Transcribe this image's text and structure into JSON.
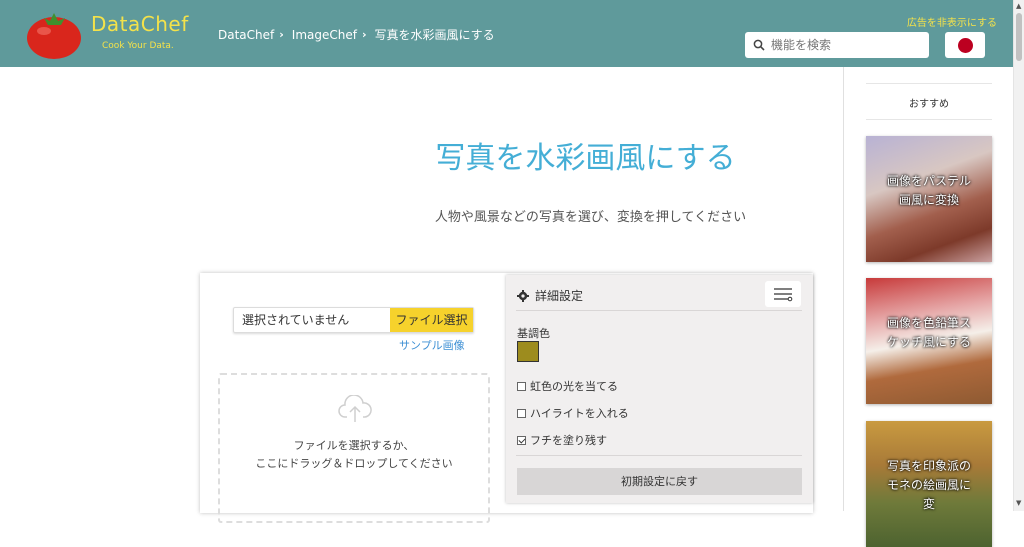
{
  "header": {
    "logo_title": "DataChef",
    "logo_tagline": "Cook Your Data.",
    "breadcrumbs": [
      "DataChef",
      "ImageChef",
      "写真を水彩画風にする"
    ],
    "ad_link": "広告を非表示にする",
    "search_placeholder": "機能を検索",
    "lang_flag": "japan-flag"
  },
  "main": {
    "title": "写真を水彩画風にする",
    "subtitle": "人物や風景などの写真を選び、変換を押してください",
    "file_value": "選択されていません",
    "file_button": "ファイル選択",
    "sample_link": "サンプル画像",
    "drop_line1": "ファイルを選択するか、",
    "drop_line2": "ここにドラッグ＆ドロップしてください"
  },
  "settings": {
    "title": "詳細設定",
    "base_color_label": "基調色",
    "base_color": "#9d8c1e",
    "options": [
      {
        "label": "虹色の光を当てる",
        "checked": false
      },
      {
        "label": "ハイライトを入れる",
        "checked": false
      },
      {
        "label": "フチを塗り残す",
        "checked": true
      }
    ],
    "reset_button": "初期設定に戻す"
  },
  "sidebar": {
    "title": "おすすめ",
    "items": [
      {
        "caption": "画像をパステル画風に変換"
      },
      {
        "caption": "画像を色鉛筆スケッチ風にする"
      },
      {
        "caption": "写真を印象派のモネの絵画風に変"
      }
    ]
  },
  "colors": {
    "header_bg": "#5f9a9b",
    "accent_yellow": "#f4e24a",
    "title_blue": "#44aed6",
    "button_yellow": "#f6d22c"
  }
}
